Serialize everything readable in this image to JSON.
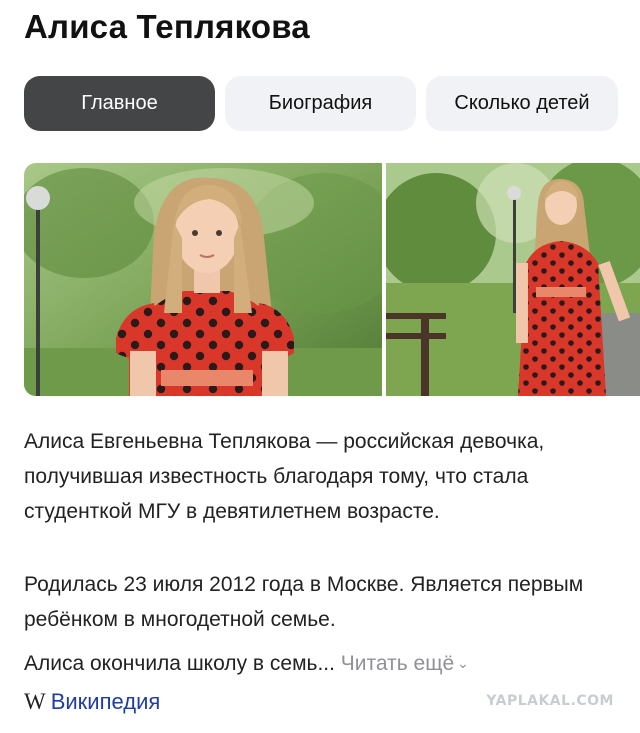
{
  "header": {
    "title": "Алиса Теплякова"
  },
  "tabs": [
    {
      "label": "Главное",
      "active": true
    },
    {
      "label": "Биография",
      "active": false
    },
    {
      "label": "Сколько детей",
      "active": false
    }
  ],
  "description": {
    "p1": "Алиса Евгеньевна Теплякова — российская девочка, получившая известность благодаря тому, что стала студенткой МГУ в девятилетнем возрасте.",
    "p2": "Родилась 23 июля 2012 года в Москве. Является первым ребёнком в многодетной семье.",
    "p3": "Алиса окончила школу в семь...",
    "read_more": "Читать ещё",
    "read_more_icon": "chevron-down-icon"
  },
  "source": {
    "logo": "W",
    "label": "Википедия"
  },
  "watermark": "YAPLAKAL.COM",
  "colors": {
    "active_tab": "#444546",
    "tab_bg": "#f1f2f5",
    "link": "#1f3f9e",
    "muted": "#8f9196",
    "dress": "#d8372a"
  }
}
